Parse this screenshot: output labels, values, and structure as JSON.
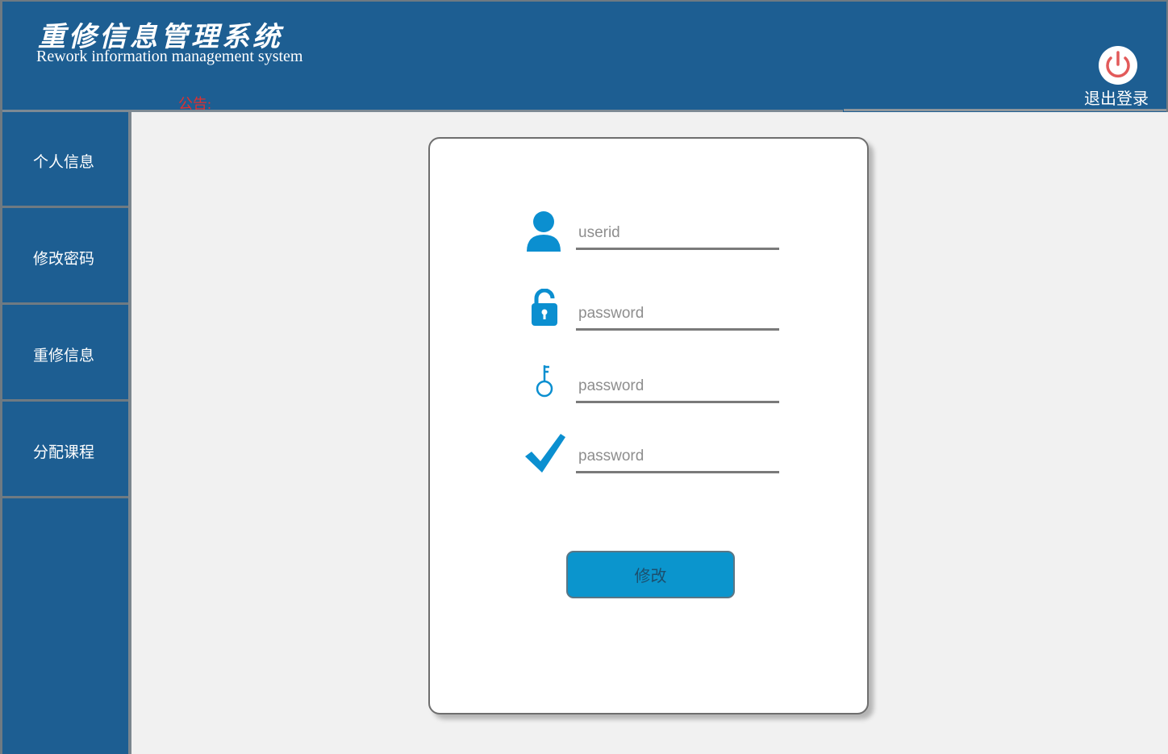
{
  "header": {
    "title_cn": "重修信息管理系统",
    "title_en": "Rework information management system",
    "notice_label": "公告:",
    "logout_label": "退出登录"
  },
  "sidebar": {
    "items": [
      {
        "label": "个人信息"
      },
      {
        "label": "修改密码"
      },
      {
        "label": "重修信息"
      },
      {
        "label": "分配课程"
      }
    ]
  },
  "form": {
    "userid_placeholder": "userid",
    "old_password_placeholder": "password",
    "new_password_placeholder": "password",
    "confirm_password_placeholder": "password",
    "submit_label": "修改"
  },
  "colors": {
    "header_bg": "#1d5e92",
    "accent": "#0b95cd",
    "notice": "#e0302f",
    "logout_icon": "#e25a5a"
  },
  "icons": [
    "user-icon",
    "lock-icon",
    "key-icon",
    "checkmark-icon",
    "power-icon"
  ]
}
